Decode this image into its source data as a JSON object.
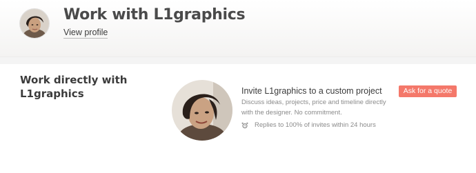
{
  "header": {
    "title": "Work with L1graphics",
    "view_profile_label": "View profile"
  },
  "main": {
    "heading": "Work directly with L1graphics",
    "invite_title": "Invite L1graphics to a custom project",
    "invite_description": "Discuss ideas, projects, price and timeline directly with the designer. No commitment.",
    "replies_text": "Replies to 100% of invites within 24 hours",
    "quote_button_label": "Ask for a quote"
  },
  "colors": {
    "accent": "#f4786a",
    "muted_text": "#8a8a8a",
    "header_bg": "#f4f3f2"
  },
  "icons": {
    "replies": "alarm-clock-icon"
  }
}
